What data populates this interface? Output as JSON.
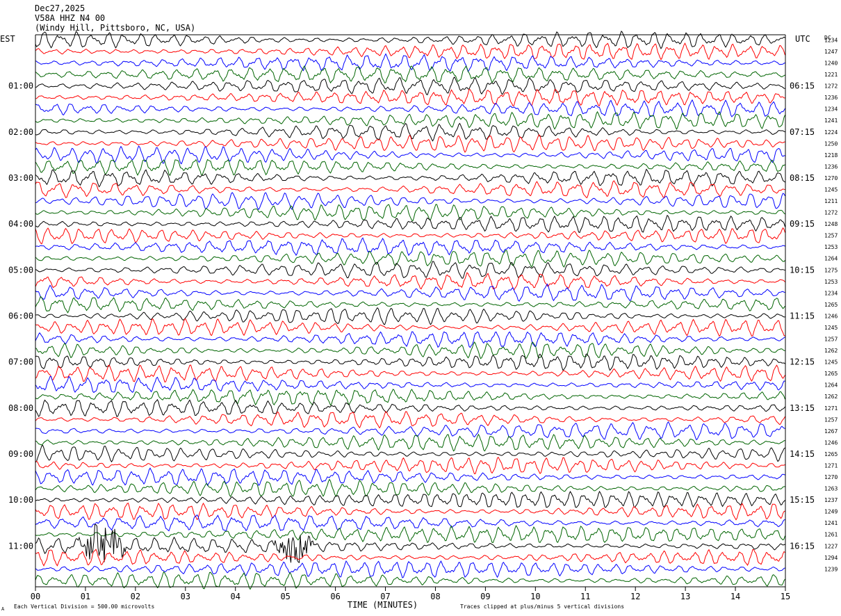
{
  "header": {
    "date": "Dec27,2025",
    "channel": "V58A HHZ N4 00",
    "location": "(Windy Hill, Pittsboro, NC, USA)"
  },
  "footer": {
    "division_note": "Each Vertical Division =  500.00 microvolts",
    "clip_note": "Traces clipped at plus/minus 5 vertical divisions",
    "corner_mark": "A"
  },
  "colors": {
    "trace_cycle": [
      "#000000",
      "#ff0000",
      "#0000ff",
      "#006400"
    ],
    "frame": "#000000",
    "background": "#ffffff"
  },
  "chart_data": {
    "type": "line",
    "subtype": "helicorder",
    "xlabel": "TIME (MINUTES)",
    "xlim": [
      0,
      15
    ],
    "x_ticks": [
      "00",
      "01",
      "02",
      "03",
      "04",
      "05",
      "06",
      "07",
      "08",
      "09",
      "10",
      "11",
      "12",
      "13",
      "14",
      "15"
    ],
    "left_axis_title": "EST",
    "right_axis_title": "UTC",
    "dc_title": "DC",
    "left_hour_labels": [
      "01:00",
      "02:00",
      "03:00",
      "04:00",
      "05:00",
      "06:00",
      "07:00",
      "08:00",
      "09:00",
      "10:00",
      "11:00"
    ],
    "right_hour_labels": [
      "06:15",
      "07:15",
      "08:15",
      "09:15",
      "10:15",
      "11:15",
      "12:15",
      "13:15",
      "14:15",
      "15:15",
      "16:15"
    ],
    "label_every_n_rows": 4,
    "first_label_row": 4,
    "dc_offsets": [
      1234,
      1247,
      1240,
      1221,
      1272,
      1236,
      1234,
      1241,
      1224,
      1250,
      1218,
      1236,
      1270,
      1245,
      1211,
      1272,
      1248,
      1257,
      1253,
      1264,
      1275,
      1253,
      1234,
      1265,
      1246,
      1245,
      1257,
      1262,
      1245,
      1265,
      1264,
      1262,
      1271,
      1257,
      1267,
      1246,
      1265,
      1271,
      1270,
      1263,
      1237,
      1249,
      1241,
      1261,
      1227,
      1294,
      1239
    ],
    "rows": 48,
    "trace_clip_divisions": 5,
    "division_microvolts": 500.0,
    "events": [
      {
        "row": 44,
        "start_min": 0.8,
        "end_min": 1.9,
        "note": "large local burst"
      },
      {
        "row": 44,
        "start_min": 4.7,
        "end_min": 5.6,
        "note": "large local burst"
      }
    ]
  }
}
